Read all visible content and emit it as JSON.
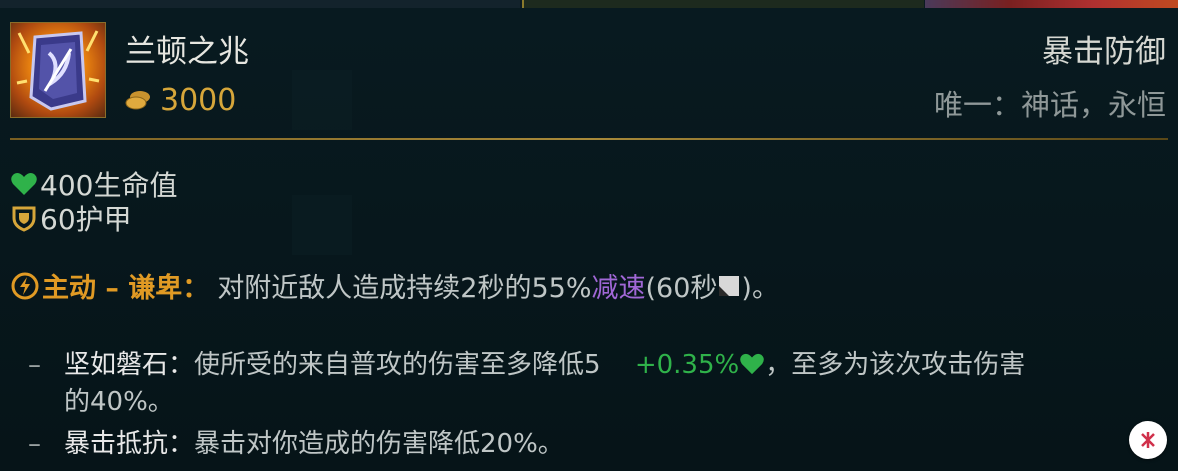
{
  "item": {
    "name": "兰顿之兆",
    "icon": "randuins-omen-icon",
    "cost": "3000",
    "category": "暴击防御",
    "unique": "唯一：神话，永恒"
  },
  "stats": [
    {
      "icon": "heart-icon",
      "text": "400生命值",
      "color": "#2fb24a"
    },
    {
      "icon": "armor-shield-icon",
      "text": "60护甲",
      "color": "#d6a63a"
    }
  ],
  "active": {
    "icon": "lightning-icon",
    "label": "主动 – 谦卑：",
    "text_before": "对附近敌人造成持续2秒的55%",
    "slow": "减速",
    "text_cd_open": "(60秒",
    "text_after": ")。"
  },
  "passives": [
    {
      "bullet": "–",
      "name": "坚如磐石：",
      "line1_text": "使所受的来自普攻的伤害至多降低5",
      "bonus": "+0.35%",
      "line1_after": "，至多为该次攻击伤害",
      "line2": "的40%。"
    },
    {
      "bullet": "–",
      "name": "暴击抵抗：",
      "text": "暴击对你造成的伤害降低20%。"
    }
  ],
  "colors": {
    "gold": "#d6a63a",
    "active": "#e09a24",
    "slow": "#a067d6",
    "health": "#2fb24a",
    "background": "#071418"
  }
}
